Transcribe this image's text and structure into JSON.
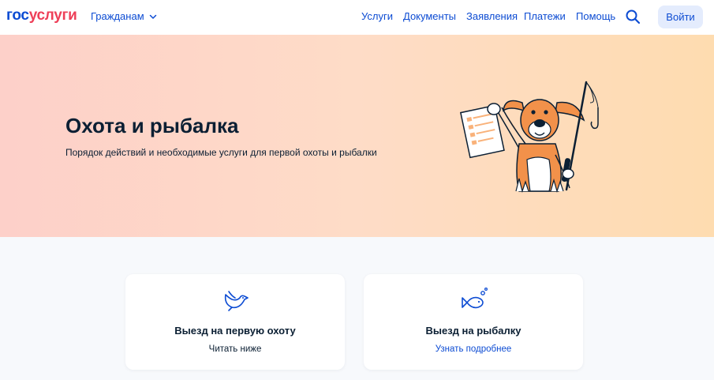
{
  "header": {
    "logo_part1": "гос",
    "logo_part2": "услуги",
    "audience": "Гражданам",
    "nav": [
      "Услуги",
      "Документы",
      "Заявления",
      "Платежи",
      "Помощь"
    ],
    "login_label": "Войти",
    "icons": [
      "search-icon",
      "chevron-down-icon"
    ]
  },
  "hero": {
    "title": "Охота и рыбалка",
    "subtitle": "Порядок действий и необходимые услуги для первой охоты и рыбалки"
  },
  "cards": [
    {
      "title": "Выезд на первую охоту",
      "link": "Читать ниже",
      "icon": "bird-icon"
    },
    {
      "title": "Выезд на рыбалку",
      "link": "Узнать подробнее",
      "icon": "fish-icon"
    }
  ],
  "colors": {
    "brand_blue": "#0d4cd3",
    "brand_red": "#ee3f58",
    "login_bg": "#e4ecfd",
    "hero_gradient_start": "#fdd0c9",
    "hero_gradient_end": "#fedcb0"
  }
}
